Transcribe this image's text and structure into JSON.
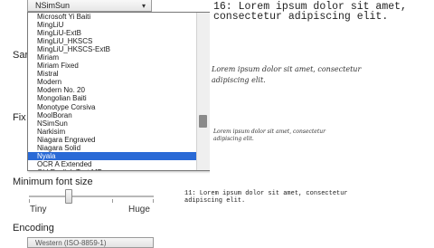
{
  "font_select": {
    "value": "NSimSun",
    "caret": "▾"
  },
  "font_list": {
    "items": [
      "Microsoft Yi Baiti",
      "MingLiU",
      "MingLiU-ExtB",
      "MingLiU_HKSCS",
      "MingLiU_HKSCS-ExtB",
      "Miriam",
      "Miriam Fixed",
      "Mistral",
      "Modern",
      "Modern No. 20",
      "Mongolian Baiti",
      "Monotype Corsiva",
      "MoolBoran",
      "NSimSun",
      "Narkisim",
      "Niagara Engraved",
      "Niagara Solid",
      "Nyala",
      "OCR A Extended",
      "Old English Text MT"
    ],
    "selected": "Nyala"
  },
  "labels": {
    "sans": "Sar",
    "fixed": "Fix",
    "min_font_size": "Minimum font size",
    "tiny": "Tiny",
    "huge": "Huge",
    "encoding": "Encoding"
  },
  "min_font_slider": {
    "value_fraction": 0.32
  },
  "encoding_select": {
    "value": "Western (ISO-8859-1)"
  },
  "preview": {
    "mono_16": "16: Lorem ipsum dolor sit amet,",
    "mono_16_line2": "consectetur adipiscing elit.",
    "script_line1": "Lorem ipsum dolor sit amet, consectetur",
    "script_line2": "adipiscing elit.",
    "script_small1": "Lorem ipsum dolor sit amet, consectetur",
    "script_small2": "adipiscing elit.",
    "mono_11_line1": "11: Lorem ipsum dolor sit amet, consectetur",
    "mono_11_line2": "adipiscing elit."
  },
  "colors": {
    "selection": "#2a6ad6",
    "border": "#7a7a7a"
  }
}
